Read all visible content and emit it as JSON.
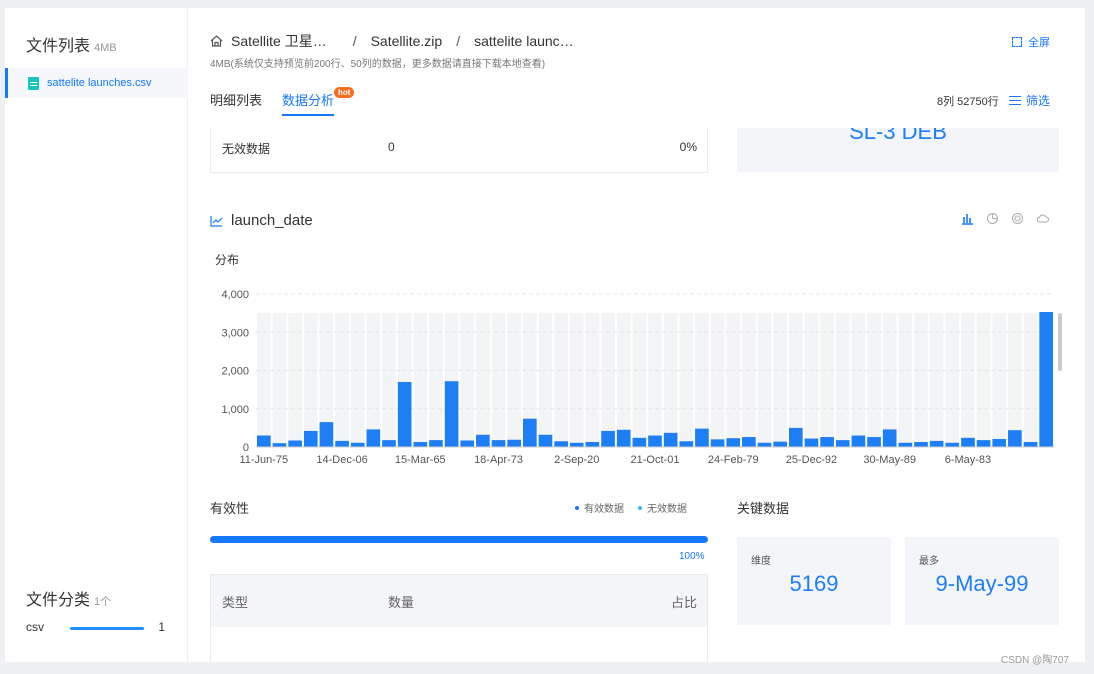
{
  "sidebar": {
    "title": "文件列表",
    "title_size": "4MB",
    "file_name": "sattelite launches.csv",
    "category_title": "文件分类",
    "category_count": "1个",
    "category_row": {
      "label": "csv",
      "count": "1"
    }
  },
  "header": {
    "breadcrumb": [
      "Satellite 卫星…",
      "Satellite.zip",
      "sattelite launc…"
    ],
    "separator": "/",
    "subtitle": "4MB(系统仅支持预览前200行、50列的数据，更多数据请直接下载本地查看)",
    "fullscreen_label": "全屏"
  },
  "tabs": [
    {
      "label": "明细列表",
      "active": false
    },
    {
      "label": "数据分析",
      "active": true,
      "badge": "hot"
    }
  ],
  "row_info": "8列 52750行",
  "filter_label": "筛选",
  "invalid_row": {
    "label": "无效数据",
    "count": "0",
    "pct": "0%"
  },
  "top_value_text": "SL-3 DEB",
  "section": {
    "title": "launch_date",
    "dist_label": "分布",
    "chart_icons": [
      "bar-chart-icon",
      "pie-chart-icon",
      "donut-chart-icon",
      "cloud-chart-icon"
    ]
  },
  "validity": {
    "title": "有效性",
    "legend": [
      {
        "label": "有效数据",
        "color": "#1677ff"
      },
      {
        "label": "无效数据",
        "color": "#36b9ee"
      }
    ],
    "progress": 1.0,
    "progress_text": "100%",
    "table_headers": [
      "类型",
      "数量",
      "占比"
    ]
  },
  "key_data": {
    "title": "关键数据",
    "cards": [
      {
        "label": "维度",
        "value": "5169"
      },
      {
        "label": "最多",
        "value": "9-May-99"
      }
    ]
  },
  "watermark": "CSDN @陶707",
  "chart_data": {
    "type": "bar",
    "ylim": [
      0,
      4000
    ],
    "yticks": [
      "0",
      "1,000",
      "2,000",
      "3,000",
      "4,000"
    ],
    "tick_labels": [
      "11-Jun-75",
      "14-Dec-06",
      "15-Mar-65",
      "18-Apr-73",
      "2-Sep-20",
      "21-Oct-01",
      "24-Feb-79",
      "25-Dec-92",
      "30-May-89",
      "6-May-83"
    ],
    "values": [
      300,
      100,
      170,
      420,
      650,
      160,
      110,
      460,
      180,
      1700,
      130,
      180,
      1720,
      170,
      320,
      180,
      190,
      740,
      320,
      150,
      110,
      130,
      420,
      450,
      240,
      300,
      370,
      150,
      480,
      200,
      230,
      260,
      110,
      140,
      500,
      220,
      260,
      180,
      300,
      260,
      460,
      110,
      130,
      160,
      110,
      240,
      180,
      210,
      440,
      130,
      3530
    ],
    "bar_color": "#1e7ef5",
    "grid": true
  }
}
